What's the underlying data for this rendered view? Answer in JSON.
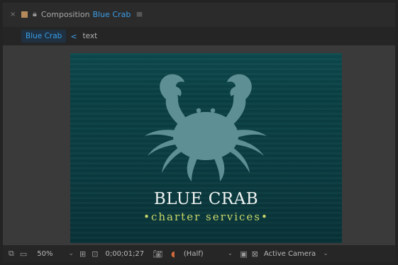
{
  "panel": {
    "label": "Composition",
    "comp_name": "Blue Crab",
    "menu_icon": "≡"
  },
  "breadcrumbs": {
    "active": "Blue Crab",
    "separator": "<",
    "next": "text"
  },
  "composition": {
    "brand": "BLUE CRAB",
    "tagline": "•charter services•"
  },
  "toolbar": {
    "zoom": "50%",
    "timecode": "0;00;01;27",
    "resolution": "(Half)",
    "view": "Active Camera"
  },
  "colors": {
    "accent": "#3b9ee8",
    "crab": "#5e8f94",
    "tagline": "#c9d86a"
  }
}
